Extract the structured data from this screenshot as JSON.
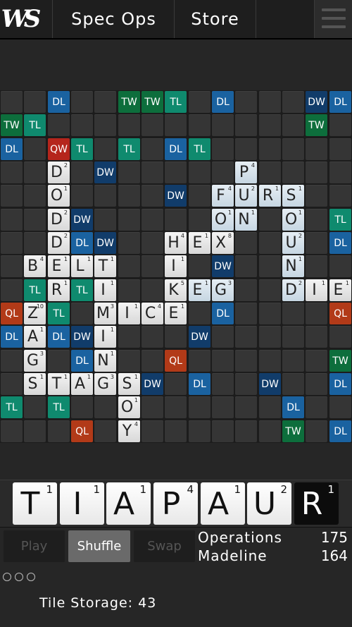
{
  "topbar": {
    "logo": "WS",
    "spec_ops_label": "Spec Ops",
    "store_label": "Store",
    "menu_icon": "hamburger-menu-icon"
  },
  "colors": {
    "DL": "#1a62a0",
    "TL": "#0f8a6e",
    "DW": "#113c6a",
    "TW": "#0d6e3c",
    "QW": "#b5251c",
    "QL": "#b23a18"
  },
  "board": {
    "size": 15,
    "bonuses": [
      [
        0,
        2,
        "DL"
      ],
      [
        0,
        5,
        "TW"
      ],
      [
        0,
        6,
        "TW"
      ],
      [
        0,
        7,
        "TL"
      ],
      [
        0,
        9,
        "DL"
      ],
      [
        0,
        13,
        "DW"
      ],
      [
        0,
        14,
        "DL"
      ],
      [
        1,
        0,
        "TW"
      ],
      [
        1,
        1,
        "TL"
      ],
      [
        1,
        13,
        "TW"
      ],
      [
        2,
        0,
        "DL"
      ],
      [
        2,
        2,
        "QW"
      ],
      [
        2,
        3,
        "TL"
      ],
      [
        2,
        5,
        "TL"
      ],
      [
        2,
        7,
        "DL"
      ],
      [
        2,
        8,
        "TL"
      ],
      [
        3,
        4,
        "DW"
      ],
      [
        4,
        7,
        "DW"
      ],
      [
        5,
        3,
        "DW"
      ],
      [
        5,
        14,
        "TL"
      ],
      [
        6,
        3,
        "DL"
      ],
      [
        6,
        4,
        "DW"
      ],
      [
        6,
        14,
        "DL"
      ],
      [
        7,
        9,
        "DW"
      ],
      [
        8,
        1,
        "TL"
      ],
      [
        8,
        3,
        "TL"
      ],
      [
        9,
        0,
        "QL"
      ],
      [
        9,
        2,
        "TL"
      ],
      [
        9,
        9,
        "DL"
      ],
      [
        9,
        14,
        "QL"
      ],
      [
        10,
        0,
        "DL"
      ],
      [
        10,
        2,
        "DL"
      ],
      [
        10,
        3,
        "DW"
      ],
      [
        10,
        8,
        "DW"
      ],
      [
        11,
        3,
        "DL"
      ],
      [
        11,
        7,
        "QL"
      ],
      [
        11,
        14,
        "TW"
      ],
      [
        12,
        6,
        "DW"
      ],
      [
        12,
        8,
        "DL"
      ],
      [
        12,
        11,
        "DW"
      ],
      [
        12,
        14,
        "DL"
      ],
      [
        13,
        0,
        "TL"
      ],
      [
        13,
        2,
        "TL"
      ],
      [
        13,
        12,
        "DL"
      ],
      [
        14,
        3,
        "QL"
      ],
      [
        14,
        12,
        "TW"
      ],
      [
        14,
        14,
        "DL"
      ]
    ],
    "tiles": [
      [
        3,
        2,
        "D",
        2,
        0
      ],
      [
        4,
        2,
        "O",
        1,
        0
      ],
      [
        5,
        2,
        "D",
        2,
        0
      ],
      [
        6,
        2,
        "D",
        2,
        0
      ],
      [
        7,
        1,
        "B",
        4,
        0
      ],
      [
        7,
        2,
        "E",
        1,
        0
      ],
      [
        7,
        3,
        "L",
        1,
        0
      ],
      [
        7,
        4,
        "T",
        1,
        0
      ],
      [
        8,
        2,
        "R",
        1,
        0
      ],
      [
        8,
        4,
        "I",
        1,
        0
      ],
      [
        9,
        1,
        "Z",
        10,
        0
      ],
      [
        9,
        4,
        "M",
        3,
        0
      ],
      [
        9,
        5,
        "I",
        1,
        0
      ],
      [
        9,
        6,
        "C",
        4,
        0
      ],
      [
        9,
        7,
        "E",
        1,
        0
      ],
      [
        10,
        1,
        "A",
        1,
        0
      ],
      [
        10,
        4,
        "I",
        1,
        0
      ],
      [
        11,
        1,
        "G",
        3,
        0
      ],
      [
        11,
        4,
        "N",
        1,
        0
      ],
      [
        12,
        1,
        "S",
        1,
        0
      ],
      [
        12,
        2,
        "T",
        1,
        0
      ],
      [
        12,
        3,
        "A",
        1,
        0
      ],
      [
        12,
        4,
        "G",
        3,
        0
      ],
      [
        12,
        5,
        "S",
        1,
        0
      ],
      [
        13,
        5,
        "O",
        1,
        0
      ],
      [
        14,
        5,
        "Y",
        4,
        0
      ],
      [
        6,
        7,
        "H",
        4,
        0
      ],
      [
        6,
        8,
        "E",
        1,
        0
      ],
      [
        6,
        9,
        "X",
        8,
        0
      ],
      [
        7,
        7,
        "I",
        1,
        0
      ],
      [
        8,
        7,
        "K",
        5,
        0
      ],
      [
        8,
        8,
        "E",
        1,
        1
      ],
      [
        8,
        9,
        "G",
        3,
        1
      ],
      [
        3,
        10,
        "P",
        4,
        1
      ],
      [
        4,
        9,
        "F",
        4,
        1
      ],
      [
        4,
        10,
        "U",
        2,
        1
      ],
      [
        4,
        11,
        "R",
        1,
        1
      ],
      [
        4,
        12,
        "S",
        1,
        1
      ],
      [
        5,
        9,
        "O",
        1,
        1
      ],
      [
        5,
        10,
        "N",
        1,
        1
      ],
      [
        5,
        12,
        "O",
        1,
        1
      ],
      [
        6,
        12,
        "U",
        2,
        1
      ],
      [
        7,
        12,
        "N",
        1,
        1
      ],
      [
        8,
        12,
        "D",
        2,
        1
      ],
      [
        8,
        13,
        "I",
        1,
        0
      ],
      [
        8,
        14,
        "E",
        1,
        0
      ]
    ]
  },
  "rack": [
    {
      "letter": "T",
      "points": "1",
      "black": false
    },
    {
      "letter": "I",
      "points": "1",
      "black": false
    },
    {
      "letter": "A",
      "points": "1",
      "black": false
    },
    {
      "letter": "P",
      "points": "4",
      "black": false
    },
    {
      "letter": "A",
      "points": "1",
      "black": false
    },
    {
      "letter": "U",
      "points": "2",
      "black": false
    },
    {
      "letter": "R",
      "points": "1",
      "black": true
    }
  ],
  "actions": {
    "play": "Play",
    "shuffle": "Shuffle",
    "swap": "Swap"
  },
  "scores": [
    {
      "name": "Operations",
      "score": "175"
    },
    {
      "name": "Madeline",
      "score": "164"
    }
  ],
  "storage": {
    "label": "Tile Storage:",
    "count": "43"
  }
}
